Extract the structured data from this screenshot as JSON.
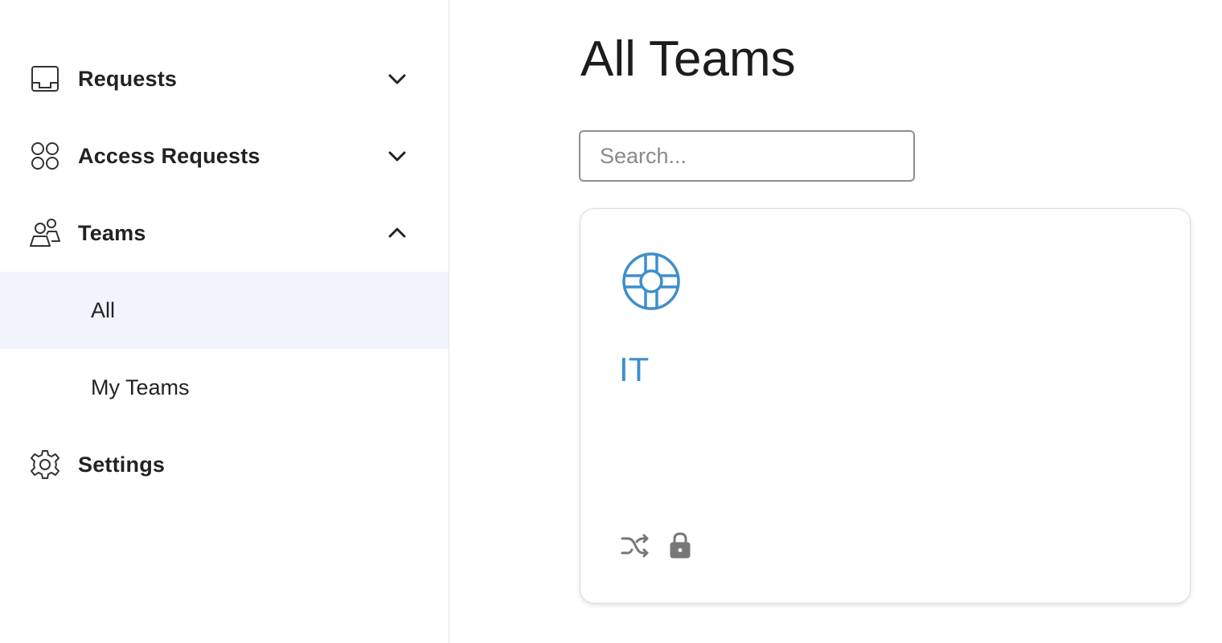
{
  "sidebar": {
    "items": [
      {
        "label": "Requests",
        "icon": "inbox-icon",
        "expanded": false
      },
      {
        "label": "Access Requests",
        "icon": "four-circles-icon",
        "expanded": false
      },
      {
        "label": "Teams",
        "icon": "people-icon",
        "expanded": true,
        "children": [
          {
            "label": "All",
            "active": true
          },
          {
            "label": "My Teams",
            "active": false
          }
        ]
      },
      {
        "label": "Settings",
        "icon": "gear-icon"
      }
    ]
  },
  "main": {
    "title": "All Teams",
    "search": {
      "placeholder": "Search...",
      "value": ""
    },
    "teams": [
      {
        "name": "IT",
        "icon": "lifebuoy-icon",
        "badges": [
          "shuffle-icon",
          "lock-icon"
        ]
      }
    ]
  },
  "colors": {
    "accent": "#3d8fcb",
    "active_bg": "#eff4fd",
    "icon_gray": "#777777"
  }
}
